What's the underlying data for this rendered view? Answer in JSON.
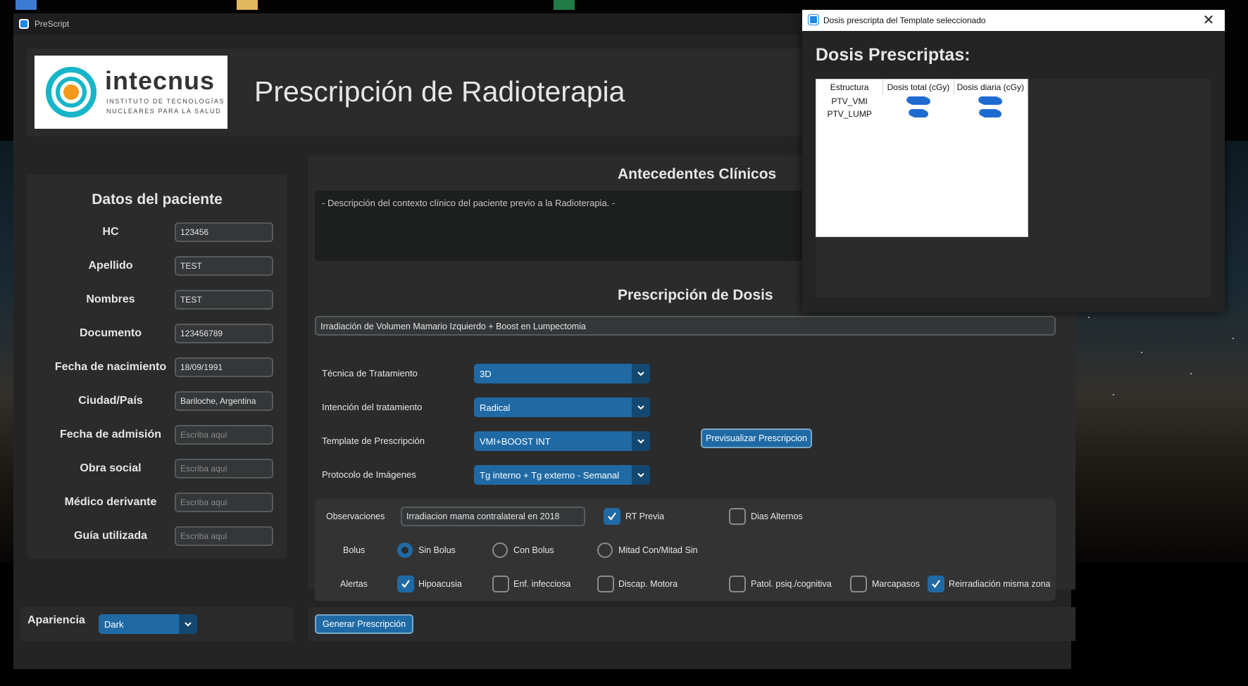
{
  "main_window": {
    "title": "PreScript",
    "header": {
      "logo_name": "intecnus",
      "logo_subtitle_line1": "INSTITUTO DE TECNOLOGÍAS",
      "logo_subtitle_line2": "NUCLEARES PARA LA SALUD",
      "page_title": "Prescripción de Radioterapia"
    },
    "patient": {
      "title": "Datos del paciente",
      "fields": [
        {
          "label": "HC",
          "value": "123456",
          "placeholder": "Escriba aquí"
        },
        {
          "label": "Apellido",
          "value": "TEST",
          "placeholder": "Escriba aquí"
        },
        {
          "label": "Nombres",
          "value": "TEST",
          "placeholder": "Escriba aquí"
        },
        {
          "label": "Documento",
          "value": "123456789",
          "placeholder": "Escriba aquí"
        },
        {
          "label": "Fecha de nacimiento",
          "value": "18/09/1991",
          "placeholder": "Escriba aquí"
        },
        {
          "label": "Ciudad/País",
          "value": "Bariloche, Argentina",
          "placeholder": "Escriba aquí"
        },
        {
          "label": "Fecha de admisión",
          "value": "",
          "placeholder": "Escriba aquí"
        },
        {
          "label": "Obra social",
          "value": "",
          "placeholder": "Escriba aquí"
        },
        {
          "label": "Médico derivante",
          "value": "",
          "placeholder": "Escriba aquí"
        },
        {
          "label": "Guía utilizada",
          "value": "",
          "placeholder": "Escriba aquí"
        }
      ]
    },
    "appearance": {
      "label": "Apariencia",
      "value": "Dark"
    },
    "clinical": {
      "title": "Antecedentes Clínicos",
      "text": "- Descripción del contexto clínico del paciente previo a la Radioterapia. -"
    },
    "dose": {
      "title": "Prescripción de Dosis",
      "prescription_name": "Irradiación de Volumen Mamario Izquierdo + Boost en Lumpectomia",
      "rows": [
        {
          "label": "Técnica de Tratamiento",
          "value": "3D"
        },
        {
          "label": "Intención del tratamiento",
          "value": "Radical"
        },
        {
          "label": "Template de Prescripción",
          "value": "VMI+BOOST INT"
        },
        {
          "label": "Protocolo de Imágenes",
          "value": "Tg interno + Tg externo - Semanal"
        }
      ],
      "preview_button": "Previsualizar Prescripcion"
    },
    "observations": {
      "label": "Observaciones",
      "value": "Irradiacion mama contralateral en 2018",
      "rt_previa": {
        "label": "RT Previa",
        "checked": true
      },
      "dias_alternos": {
        "label": "Dias Alternos",
        "checked": false
      }
    },
    "bolus": {
      "label": "Bolus",
      "options": [
        {
          "label": "Sin Bolus",
          "selected": true
        },
        {
          "label": "Con Bolus",
          "selected": false
        },
        {
          "label": "Mitad Con/Mitad Sin",
          "selected": false
        }
      ]
    },
    "alerts": {
      "label": "Alertas",
      "items": [
        {
          "label": "Hipoacusia",
          "checked": true
        },
        {
          "label": "Enf. infecciosa",
          "checked": false
        },
        {
          "label": "Discap. Motora",
          "checked": false
        },
        {
          "label": "Patol. psiq./cognitiva",
          "checked": false
        },
        {
          "label": "Marcapasos",
          "checked": false
        },
        {
          "label": "Reirradiación misma zona",
          "checked": true
        }
      ]
    },
    "generate_button": "Generar Prescripción"
  },
  "popup": {
    "title": "Dosis prescripta del Template seleccionado",
    "close_glyph": "✕",
    "heading": "Dosis Prescriptas:",
    "table": {
      "headers": [
        "Estructura",
        "Dosis total (cGy)",
        "Dosis diaria (cGy)"
      ],
      "rows": [
        {
          "structure": "PTV_VMI"
        },
        {
          "structure": "PTV_LUMP"
        }
      ]
    }
  },
  "colors": {
    "accent": "#1f6aa5",
    "accent_dark": "#144870",
    "window_bg": "#242424",
    "panel_bg": "#2b2b2b",
    "logo_teal": "#17b5c8",
    "logo_orange": "#f39a1e"
  },
  "icons": {
    "dropdown": "chevron-down-icon",
    "checkbox": "checkmark-icon",
    "close": "close-icon",
    "app": "app-icon"
  }
}
